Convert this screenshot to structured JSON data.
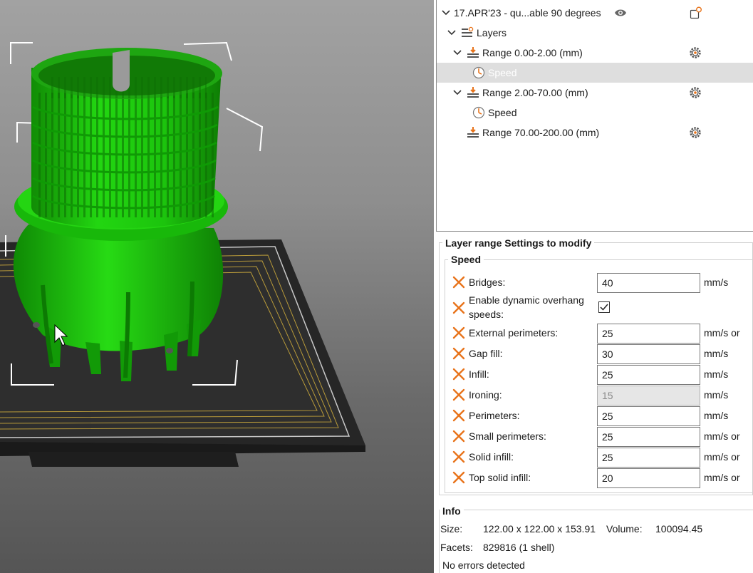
{
  "tree": {
    "object_name": "17.APR'23 - qu...able 90 degrees",
    "layers_label": "Layers",
    "items": [
      {
        "label": "Range 0.00-2.00 (mm)"
      },
      {
        "label": "Speed"
      },
      {
        "label": "Range 2.00-70.00 (mm)"
      },
      {
        "label": "Speed"
      },
      {
        "label": "Range 70.00-200.00 (mm)"
      }
    ]
  },
  "settings": {
    "title": "Layer range Settings to modify",
    "group": "Speed",
    "rows": [
      {
        "label": "Bridges:",
        "value": "40",
        "unit": "mm/s"
      },
      {
        "label_line1": "Enable dynamic overhang",
        "label_line2": "speeds:",
        "checked": true
      },
      {
        "label": "External perimeters:",
        "value": "25",
        "unit": "mm/s or"
      },
      {
        "label": "Gap fill:",
        "value": "30",
        "unit": "mm/s"
      },
      {
        "label": "Infill:",
        "value": "25",
        "unit": "mm/s"
      },
      {
        "label": "Ironing:",
        "value": "15",
        "unit": "mm/s",
        "disabled": true
      },
      {
        "label": "Perimeters:",
        "value": "25",
        "unit": "mm/s"
      },
      {
        "label": "Small perimeters:",
        "value": "25",
        "unit": "mm/s or"
      },
      {
        "label": "Solid infill:",
        "value": "25",
        "unit": "mm/s or"
      },
      {
        "label": "Top solid infill:",
        "value": "20",
        "unit": "mm/s or"
      }
    ]
  },
  "info": {
    "title": "Info",
    "size_label": "Size:",
    "size_value": "122.00 x 122.00 x 153.91",
    "volume_label": "Volume:",
    "volume_value": "100094.45",
    "facets_label": "Facets:",
    "facets_value": "829816 (1 shell)",
    "errors": "No errors detected"
  },
  "colors": {
    "model": "#1fcf0f",
    "accent": "#e8731a",
    "bed": "#2a2a2a"
  }
}
